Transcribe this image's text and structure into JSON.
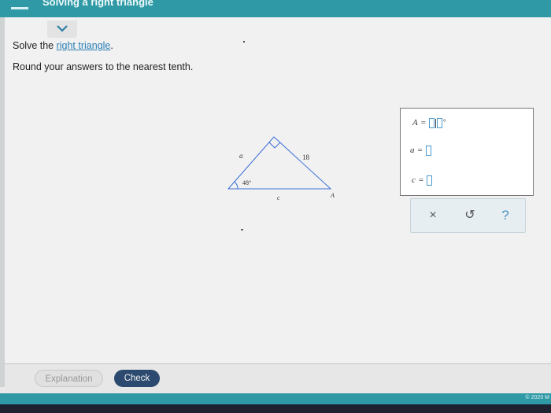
{
  "header": {
    "title": "Solving a right triangle"
  },
  "problem": {
    "line1_prefix": "Solve the ",
    "line1_link": "right triangle",
    "line1_suffix": ".",
    "line2": "Round your answers to the nearest tenth."
  },
  "triangle": {
    "label_a": "a",
    "label_hyp": "18",
    "label_angle": "48°",
    "label_c": "c",
    "label_A": "A"
  },
  "answers": {
    "A_label": "A",
    "a_label": "a",
    "c_label": "c",
    "equals": "=",
    "degree": "°"
  },
  "tools": {
    "clear_icon": "×",
    "undo_icon": "↺",
    "help_icon": "?"
  },
  "footer": {
    "explanation_label": "Explanation",
    "check_label": "Check",
    "copyright": "© 2020 M"
  },
  "colors": {
    "accent": "#2f9aa6",
    "check_button": "#2c4a6f",
    "triangle_stroke": "#3b6fd8",
    "input_border": "#4a9bd0"
  }
}
